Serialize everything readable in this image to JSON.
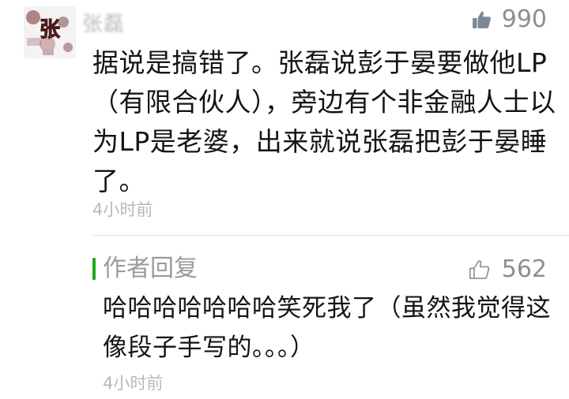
{
  "comment": {
    "avatar_text": "张",
    "username": "张磊",
    "likes": "990",
    "body": "据说是搞错了。张磊说彭于晏要做他LP（有限合伙人），旁边有个非金融人士以为LP是老婆，出来就说张磊把彭于晏睡了。",
    "time": "4小时前",
    "like_icon": "thumbs-up-filled-icon"
  },
  "reply": {
    "label": "作者回复",
    "likes": "562",
    "body": "哈哈哈哈哈哈哈笑死我了（虽然我觉得这像段子手写的。。。）",
    "time": "4小时前",
    "like_icon": "thumbs-up-outline-icon"
  },
  "colors": {
    "accent_green": "#1aad19",
    "meta_gray": "#b8b8b8",
    "count_gray": "#8e8e8e"
  }
}
